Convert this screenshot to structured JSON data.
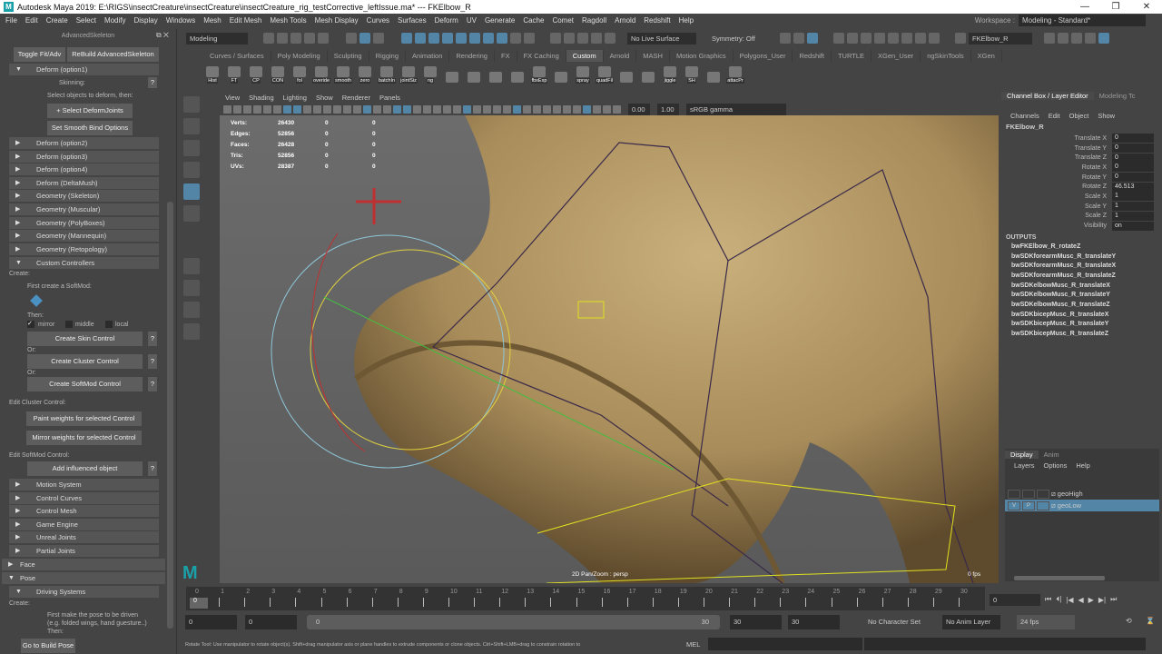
{
  "title": "Autodesk Maya 2019: E:\\RIGS\\insectCreature\\insectCreature\\insectCreature_rig_testCorrective_leftIssue.ma*  ---  FKElbow_R",
  "menu": [
    "File",
    "Edit",
    "Create",
    "Select",
    "Modify",
    "Display",
    "Windows",
    "Mesh",
    "Edit Mesh",
    "Mesh Tools",
    "Mesh Display",
    "Curves",
    "Surfaces",
    "Deform",
    "UV",
    "Generate",
    "Cache",
    "Comet",
    "Ragdoll",
    "Arnold",
    "Redshift",
    "Help"
  ],
  "workspace": {
    "label": "Workspace :",
    "value": "Modeling - Standard*"
  },
  "status": {
    "mode": "Modeling",
    "live_surface": "No Live Surface",
    "symmetry": "Symmetry: Off",
    "object_name": "FKElbow_R"
  },
  "shelf_tabs": [
    "Curves / Surfaces",
    "Poly Modeling",
    "Sculpting",
    "Rigging",
    "Animation",
    "Rendering",
    "FX",
    "FX Caching",
    "Custom",
    "Arnold",
    "MASH",
    "Motion Graphics",
    "Polygons_User",
    "Redshift",
    "TURTLE",
    "XGen_User",
    "ngSkinTools",
    "XGen"
  ],
  "shelf_active": "Custom",
  "shelf_items": [
    "Hist",
    "FT",
    "CP",
    "CON",
    "fol",
    "overide",
    "smooth",
    "zero",
    "batchIn",
    "jointSiz",
    "ng",
    "",
    "",
    "",
    "",
    "fbxExp",
    "",
    "spray",
    "quadFil",
    "",
    "",
    "jiggle",
    "SH",
    "",
    "attacPr"
  ],
  "left": {
    "title": "AdvancedSkeleton",
    "toggle": "Toggle Fit/Adv",
    "rebuild": "ReBuild AdvancedSkeleton",
    "deform1": "Deform     (option1)",
    "skinning": "Skinning:",
    "select_hint": "Select objects to deform, then:",
    "select_joints": "+ Select DeformJoints",
    "smooth_bind": "Set Smooth Bind Options",
    "frames1": [
      "Deform     (option2)",
      "Deform     (option3)",
      "Deform     (option4)",
      "Deform     (DeltaMush)",
      "Geometry (Skeleton)",
      "Geometry (Muscular)",
      "Geometry (PolyBoxes)",
      "Geometry (Mannequin)",
      "Geometry (Retopology)"
    ],
    "custom": "Custom Controllers",
    "create": "Create:",
    "first_softmod": "First create a SoftMod:",
    "then": "Then:",
    "mirror": "mirror",
    "middle": "middle",
    "local": "local",
    "skin_ctrl": "Create Skin Control",
    "or": "Or:",
    "cluster_ctrl": "Create Cluster Control",
    "softmod_ctrl": "Create SoftMod Control",
    "help": "?",
    "edit_cluster": "Edit Cluster Control:",
    "paint_w": "Paint weights for selected Control",
    "mirror_w": "Mirror weights for selected Control",
    "edit_softmod": "Edit SoftMod Control:",
    "add_infl": "Add influenced object",
    "frames2": [
      "Motion System",
      "Control Curves",
      "Control Mesh",
      "Game Engine",
      "Unreal Joints",
      "Partial Joints"
    ],
    "face": "Face",
    "pose": "Pose",
    "driving": "Driving Systems",
    "create2": "Create:",
    "pose_hint1": "First make the pose to be driven",
    "pose_hint2": "(e.g. folded wings, hand guesture..)",
    "pose_hint3": "Then:",
    "goto_pose": "Go to Build Pose"
  },
  "viewport": {
    "menu": [
      "View",
      "Shading",
      "Lighting",
      "Show",
      "Renderer",
      "Panels"
    ],
    "exposure": "0.00",
    "gamma": "1.00",
    "colorspace": "sRGB gamma",
    "hud": [
      [
        "Verts:",
        "26430",
        "0",
        "0"
      ],
      [
        "Edges:",
        "52856",
        "0",
        "0"
      ],
      [
        "Faces:",
        "26428",
        "0",
        "0"
      ],
      [
        "Tris:",
        "52856",
        "0",
        "0"
      ],
      [
        "UVs:",
        "28387",
        "0",
        "0"
      ]
    ],
    "camera": "2D Pan/Zoom : persp",
    "fps": "0 fps"
  },
  "channelbox": {
    "tabs": [
      "Channel Box / Layer Editor",
      "Modeling Tc"
    ],
    "menu": [
      "Channels",
      "Edit",
      "Object",
      "Show"
    ],
    "node": "FKElbow_R",
    "attrs": [
      [
        "Translate X",
        "0"
      ],
      [
        "Translate Y",
        "0"
      ],
      [
        "Translate Z",
        "0"
      ],
      [
        "Rotate X",
        "0"
      ],
      [
        "Rotate Y",
        "0"
      ],
      [
        "Rotate Z",
        "46.513"
      ],
      [
        "Scale X",
        "1"
      ],
      [
        "Scale Y",
        "1"
      ],
      [
        "Scale Z",
        "1"
      ],
      [
        "Visibility",
        "on"
      ]
    ],
    "outputs_label": "OUTPUTS",
    "outputs": [
      "bwFKElbow_R_rotateZ",
      "bwSDKforearmMusc_R_translateY",
      "bwSDKforearmMusc_R_translateX",
      "bwSDKforearmMusc_R_translateZ",
      "bwSDKelbowMusc_R_translateX",
      "bwSDKelbowMusc_R_translateY",
      "bwSDKelbowMusc_R_translateZ",
      "bwSDKbicepMusc_R_translateX",
      "bwSDKbicepMusc_R_translateY",
      "bwSDKbicepMusc_R_translateZ"
    ]
  },
  "layers": {
    "tabs": [
      "Display",
      "Anim"
    ],
    "menu": [
      "Layers",
      "Options",
      "Help"
    ],
    "items": [
      {
        "name": "geoHigh",
        "v": "",
        "p": ""
      },
      {
        "name": "geoLow",
        "v": "V",
        "p": "P"
      }
    ]
  },
  "timeline": {
    "ticks": [
      "0",
      "1",
      "2",
      "3",
      "4",
      "5",
      "6",
      "7",
      "8",
      "9",
      "10",
      "11",
      "12",
      "13",
      "14",
      "15",
      "16",
      "17",
      "18",
      "19",
      "20",
      "21",
      "22",
      "23",
      "24",
      "25",
      "26",
      "27",
      "28",
      "29",
      "30"
    ],
    "current": "0",
    "current_field": "0"
  },
  "range": {
    "start": "0",
    "anim_start": "0",
    "slider_start": "0",
    "slider_end": "30",
    "anim_end": "30",
    "end": "30",
    "character_set": "No Character Set",
    "anim_layer": "No Anim Layer",
    "fps": "24 fps"
  },
  "cmd": {
    "lang": "MEL",
    "help": "Rotate Tool: Use manipulator to rotate object(s). Shift+drag manipulator axis or plane handles to extrude components or clone objects. Ctrl+Shift+LMB+drag to constrain rotation to"
  }
}
